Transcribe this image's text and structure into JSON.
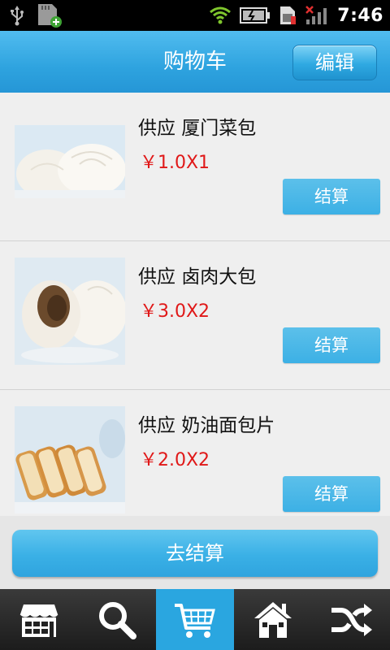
{
  "status_bar": {
    "time": "7:46",
    "left_icons": [
      "usb-icon",
      "sd-card-icon"
    ],
    "right_icons": [
      "wifi-icon",
      "battery-icon",
      "sim-icon",
      "signal-icon"
    ]
  },
  "header": {
    "title": "购物车",
    "edit_label": "编辑"
  },
  "cart": {
    "items": [
      {
        "name": "供应 厦门菜包",
        "price": "￥1.0X1",
        "pay_label": "结算",
        "image": "steamed-bun-image"
      },
      {
        "name": "供应 卤肉大包",
        "price": "￥3.0X2",
        "pay_label": "结算",
        "image": "meat-bun-image"
      },
      {
        "name": "供应 奶油面包片",
        "price": "￥2.0X2",
        "pay_label": "结算",
        "image": "bread-slices-image"
      }
    ]
  },
  "checkout": {
    "label": "去结算"
  },
  "bottom_nav": {
    "items": [
      {
        "icon": "store-icon",
        "active": false
      },
      {
        "icon": "search-icon",
        "active": false
      },
      {
        "icon": "cart-icon",
        "active": true
      },
      {
        "icon": "home-icon",
        "active": false
      },
      {
        "icon": "shuffle-icon",
        "active": false
      }
    ]
  },
  "colors": {
    "accent": "#2ea3df",
    "price": "#e01818",
    "button": "#3cb0e5"
  }
}
